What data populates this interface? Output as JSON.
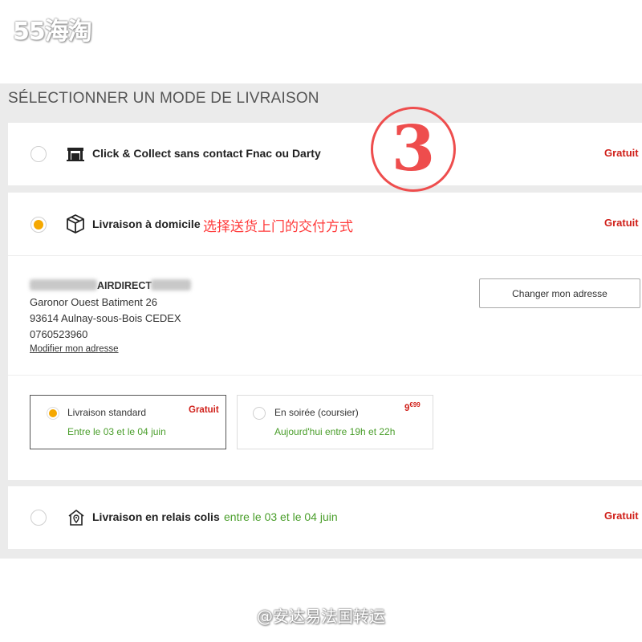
{
  "watermark": {
    "top": "55海淘",
    "bottom": "@安达易法国转运"
  },
  "section_title": "SÉLECTIONNER UN MODE DE LIVRAISON",
  "annotation": {
    "number": "3",
    "note": "选择送货上门的交付方式"
  },
  "options": {
    "click_collect": {
      "label": "Click & Collect sans contact Fnac ou Darty",
      "price": "Gratuit",
      "icon": "store-icon",
      "selected": false
    },
    "domicile": {
      "label": "Livraison à domicile",
      "price": "Gratuit",
      "icon": "package-icon",
      "selected": true
    },
    "relais": {
      "label": "Livraison en relais colis",
      "date": "entre le 03 et le 04 juin",
      "price": "Gratuit",
      "icon": "relay-point-icon",
      "selected": false
    }
  },
  "address": {
    "name": "AIRDIRECT",
    "line1": "Garonor Ouest Batiment 26",
    "line2": "93614 Aulnay-sous-Bois CEDEX",
    "phone": "0760523960",
    "modify_link": "Modifier mon adresse",
    "change_button": "Changer mon adresse"
  },
  "sub_options": [
    {
      "title": "Livraison standard",
      "date": "Entre le 03 et le 04 juin",
      "price": "Gratuit",
      "selected": true
    },
    {
      "title": "En soirée (coursier)",
      "date": "Aujourd'hui entre 19h et 22h",
      "price_main": "9",
      "price_cents": "€99",
      "selected": false
    }
  ],
  "colors": {
    "accent": "#f5a800",
    "price": "#d0201a",
    "date": "#4a9e2b",
    "annotation": "#ee4d4d"
  }
}
